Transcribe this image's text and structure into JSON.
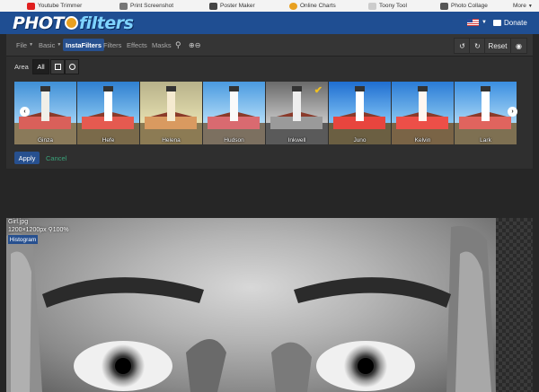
{
  "topbar": {
    "links": [
      {
        "label": "Youtube Trimmer",
        "icon": "youtube-icon",
        "color": "#e02020"
      },
      {
        "label": "Print Screenshot",
        "icon": "printer-icon",
        "color": "#777777"
      },
      {
        "label": "Poster Maker",
        "icon": "poster-icon",
        "color": "#444444"
      },
      {
        "label": "Online Charts",
        "icon": "chart-icon",
        "color": "#e8a020"
      },
      {
        "label": "Toony Tool",
        "icon": "toony-icon",
        "color": "#cccccc"
      },
      {
        "label": "Photo Collage",
        "icon": "collage-icon",
        "color": "#555555"
      }
    ],
    "more": "More"
  },
  "header": {
    "logo_part1": "PHOT",
    "logo_part2": "filters",
    "donate": "Donate",
    "bg_color": "#1f4e92"
  },
  "toolbar": {
    "menus": [
      "File",
      "Basic",
      "InstaFilters",
      "Filters",
      "Effects",
      "Masks"
    ],
    "active_menu": "InstaFilters",
    "reset": "Reset"
  },
  "area": {
    "label": "Area",
    "all": "All"
  },
  "filters": [
    {
      "name": "Ginza",
      "selected": false
    },
    {
      "name": "Hefe",
      "selected": false
    },
    {
      "name": "Helena",
      "selected": false
    },
    {
      "name": "Hudson",
      "selected": false
    },
    {
      "name": "Inkwell",
      "selected": true
    },
    {
      "name": "Juno",
      "selected": false
    },
    {
      "name": "Kelvin",
      "selected": false
    },
    {
      "name": "Lark",
      "selected": false
    }
  ],
  "actions": {
    "apply": "Apply",
    "cancel": "Cancel"
  },
  "image_info": {
    "filename": "Girl.jpg",
    "dimensions": "1200×1200px",
    "zoom": "100%",
    "histogram": "Histogram"
  }
}
